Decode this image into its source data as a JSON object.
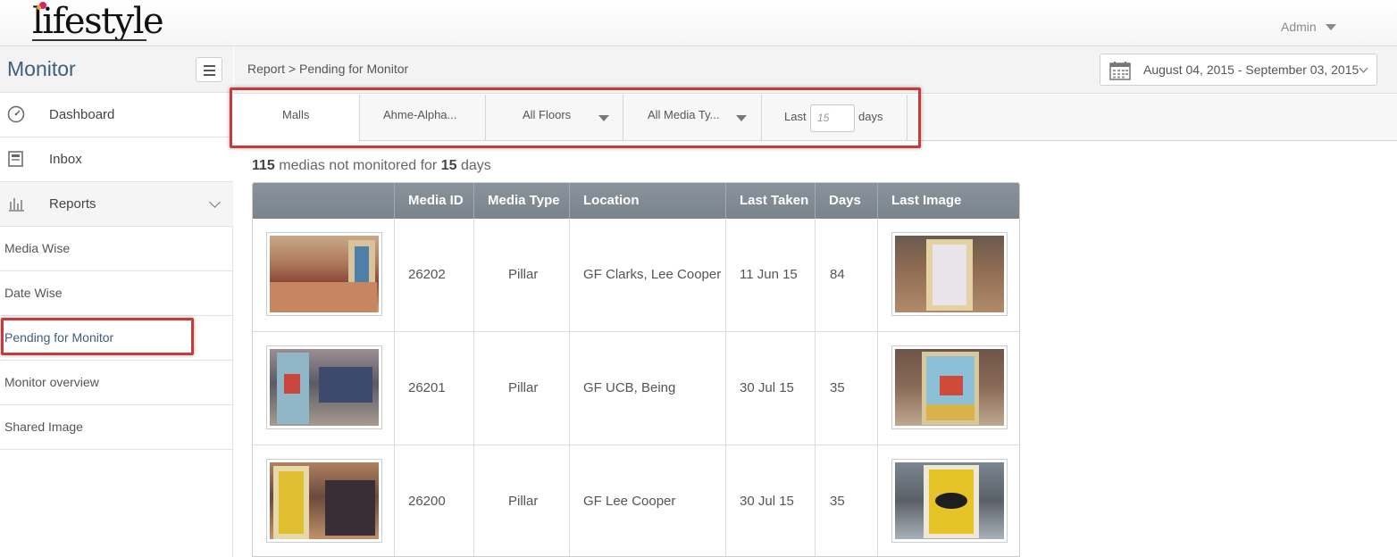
{
  "header": {
    "logo_text": "lifestyle",
    "user_label": "Admin"
  },
  "sidebar": {
    "title": "Monitor",
    "nav": [
      {
        "label": "Dashboard",
        "icon": "gauge-icon"
      },
      {
        "label": "Inbox",
        "icon": "inbox-icon"
      },
      {
        "label": "Reports",
        "icon": "bar-chart-icon"
      }
    ],
    "sub_items": [
      {
        "label": "Media Wise"
      },
      {
        "label": "Date Wise"
      },
      {
        "label": "Pending for Monitor"
      },
      {
        "label": "Monitor overview"
      },
      {
        "label": "Shared Image"
      }
    ]
  },
  "breadcrumb": "Report > Pending for Monitor",
  "date_range": "August 04, 2015 - September 03, 2015",
  "filters": {
    "malls": "Malls",
    "mall_value": "Ahme-Alpha...",
    "floors": "All Floors",
    "media_types": "All Media Ty...",
    "last_label": "Last",
    "days_value": "15",
    "days_label": "days"
  },
  "summary": {
    "count": "115",
    "middle_text": "medias not monitored for",
    "days": "15",
    "unit": "days"
  },
  "table": {
    "columns": [
      "",
      "Media ID",
      "Media Type",
      "Location",
      "Last Taken",
      "Days",
      "Last Image"
    ],
    "rows": [
      {
        "media_id": "26202",
        "media_type": "Pillar",
        "location": "GF Clarks, Lee Cooper",
        "last_taken": "11 Jun 15",
        "days": "84"
      },
      {
        "media_id": "26201",
        "media_type": "Pillar",
        "location": "GF UCB, Being",
        "last_taken": "30 Jul 15",
        "days": "35"
      },
      {
        "media_id": "26200",
        "media_type": "Pillar",
        "location": "GF Lee Cooper",
        "last_taken": "30 Jul 15",
        "days": "35"
      }
    ]
  },
  "colors": {
    "accent": "#3e5e7c",
    "table_header": "#7f8992",
    "highlight_box": "#c9393a"
  }
}
